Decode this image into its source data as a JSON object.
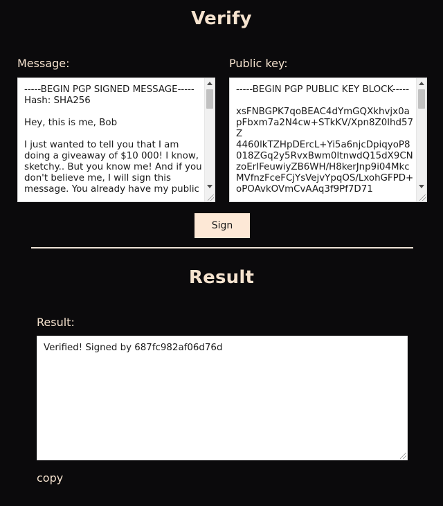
{
  "verify": {
    "title": "Verify",
    "message_label": "Message:",
    "message_value": "-----BEGIN PGP SIGNED MESSAGE-----\nHash: SHA256\n\nHey, this is me, Bob\n\nI just wanted to tell you that I am doing a giveaway of $10 000! I know, sketchy.. But you know me! And if you don't believe me, I will sign this message. You already have my public",
    "public_key_label": "Public key:",
    "public_key_value": "-----BEGIN PGP PUBLIC KEY BLOCK-----\n\nxsFNBGPK7qoBEAC4dYmGQXkhvjx0apFbxm7a2N4cw+STkKV/Xpn8Z0lhd57Z\n4460lkTZHpDErcL+Yi5a6njcDpiqyoP8018ZGq2y5RvxBwm0ItnwdQ15dX9CNzoErIFeuwiyZB6WH/H8kerJnp9i04MkcMVfnzFceFCjYsVejvYpqOS/LxohGFPD+oPOAvkOVmCvAAq3f9Pf7D71",
    "sign_button": "Sign"
  },
  "result": {
    "title": "Result",
    "result_label": "Result:",
    "result_value": "Verified! Signed by 687fc982af06d76d",
    "copy_label": "copy"
  }
}
